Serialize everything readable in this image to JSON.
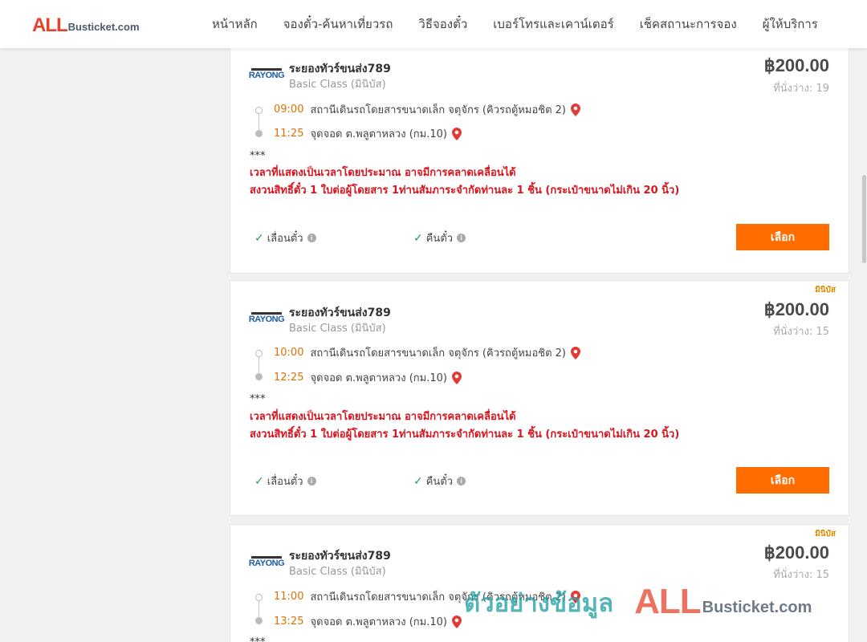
{
  "header": {
    "logo_all": "ALL",
    "logo_rest": "Busticket.com",
    "nav": [
      {
        "label": "หน้าหลัก"
      },
      {
        "label": "จองตั๋ว-ค้นหาเที่ยวรถ"
      },
      {
        "label": "วิธีจองตั๋ว"
      },
      {
        "label": "เบอร์โทรและเคาน์เตอร์"
      },
      {
        "label": "เช็คสถานะการจอง"
      },
      {
        "label": "ผู้ให้บริการ"
      }
    ]
  },
  "trips": [
    {
      "badge": "",
      "company_logo_text": "RAYONG",
      "company": "ระยองทัวร์ขนส่ง789",
      "class": "Basic Class (มินิบัส)",
      "price": "฿200.00",
      "seats": "ที่นั่งว่าง: 19",
      "depart_time": "09:00",
      "depart_place": "สถานีเดินรถโดยสารขนาดเล็ก จตุจักร (คิวรถตู้หมอชิต 2)",
      "arrive_time": "11:25",
      "arrive_place": "จุดจอด ต.พลูตาหลวง (กม.10)",
      "stars": "***",
      "notice1": "เวลาที่แสดงเป็นเวลาโดยประมาณ อาจมีการคลาดเคลื่อนได้",
      "notice2": "สงวนสิทธิ์ตั๋ว 1 ใบต่อผู้โดยสาร 1ท่านสัมภาระจำกัดท่านละ 1 ชิ้น (กระเป๋าขนาดไม่เกิน 20 นิ้ว)",
      "feature1": "เลื่อนตั๋ว",
      "feature2": "คืนตั๋ว",
      "select_label": "เลือก"
    },
    {
      "badge": "มินิบัส",
      "company_logo_text": "RAYONG",
      "company": "ระยองทัวร์ขนส่ง789",
      "class": "Basic Class (มินิบัส)",
      "price": "฿200.00",
      "seats": "ที่นั่งว่าง: 15",
      "depart_time": "10:00",
      "depart_place": "สถานีเดินรถโดยสารขนาดเล็ก จตุจักร (คิวรถตู้หมอชิต 2)",
      "arrive_time": "12:25",
      "arrive_place": "จุดจอด ต.พลูตาหลวง (กม.10)",
      "stars": "***",
      "notice1": "เวลาที่แสดงเป็นเวลาโดยประมาณ อาจมีการคลาดเคลื่อนได้",
      "notice2": "สงวนสิทธิ์ตั๋ว 1 ใบต่อผู้โดยสาร 1ท่านสัมภาระจำกัดท่านละ 1 ชิ้น (กระเป๋าขนาดไม่เกิน 20 นิ้ว)",
      "feature1": "เลื่อนตั๋ว",
      "feature2": "คืนตั๋ว",
      "select_label": "เลือก"
    },
    {
      "badge": "มินิบัส",
      "company_logo_text": "RAYONG",
      "company": "ระยองทัวร์ขนส่ง789",
      "class": "Basic Class (มินิบัส)",
      "price": "฿200.00",
      "seats": "ที่นั่งว่าง: 15",
      "depart_time": "11:00",
      "depart_place": "สถานีเดินรถโดยสารขนาดเล็ก จตุจักร (คิวรถตู้หมอชิต 2)",
      "arrive_time": "13:25",
      "arrive_place": "จุดจอด ต.พลูตาหลวง (กม.10)",
      "stars": "***"
    }
  ],
  "watermark": {
    "thai": "ตัวอย่างข้อมูล",
    "all": "ALL",
    "rest": "Busticket.com"
  }
}
